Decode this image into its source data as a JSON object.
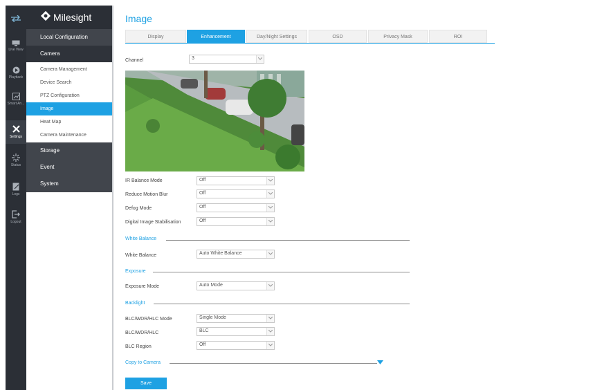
{
  "brand": {
    "name": "Milesight"
  },
  "rail": [
    {
      "label": "",
      "icon": "arrows-swap-icon"
    },
    {
      "label": "Live View",
      "icon": "monitor-icon"
    },
    {
      "label": "Playback",
      "icon": "playback-icon"
    },
    {
      "label": "Smart An...",
      "icon": "smart-analytics-icon"
    },
    {
      "label": "Settings",
      "icon": "settings-tools-icon"
    },
    {
      "label": "Status",
      "icon": "status-icon"
    },
    {
      "label": "Logs",
      "icon": "logs-icon"
    },
    {
      "label": "Logout",
      "icon": "logout-icon"
    }
  ],
  "menu": {
    "local_configuration": "Local Configuration",
    "camera": "Camera",
    "camera_items": [
      "Camera Management",
      "Device Search",
      "PTZ Configuration",
      "Image",
      "Heat Map",
      "Camera Maintenance"
    ],
    "storage": "Storage",
    "event": "Event",
    "system": "System"
  },
  "page": {
    "title": "Image",
    "tabs": [
      "Display",
      "Enhancement",
      "Day/Night Settings",
      "OSD",
      "Privacy Mask",
      "ROI"
    ],
    "active_tab": "Enhancement"
  },
  "form": {
    "channel": {
      "label": "Channel",
      "value": "3"
    },
    "ir_balance_mode": {
      "label": "IR Balance Mode",
      "value": "Off"
    },
    "reduce_motion_blur": {
      "label": "Reduce Motion Blur",
      "value": "Off"
    },
    "defog_mode": {
      "label": "Defog Mode",
      "value": "Off"
    },
    "digital_image_stabilisation": {
      "label": "Digital Image Stabilisation",
      "value": "Off"
    },
    "white_balance_section": "White Balance",
    "white_balance": {
      "label": "White Balance",
      "value": "Auto White Balance"
    },
    "exposure_section": "Exposure",
    "exposure_mode": {
      "label": "Exposure Mode",
      "value": "Auto Mode"
    },
    "backlight_section": "Backlight",
    "blc_wdr_hlc_mode": {
      "label": "BLC/WDR/HLC Mode",
      "value": "Single Mode"
    },
    "blc_wdr_hlc": {
      "label": "BLC/WDR/HLC",
      "value": "BLC"
    },
    "blc_region": {
      "label": "BLC Region",
      "value": "Off"
    },
    "copy_to_camera": "Copy to Camera",
    "save": "Save"
  },
  "colors": {
    "accent": "#1ea1e3",
    "rail": "#2b2f36",
    "menu_head": "#41454c"
  }
}
